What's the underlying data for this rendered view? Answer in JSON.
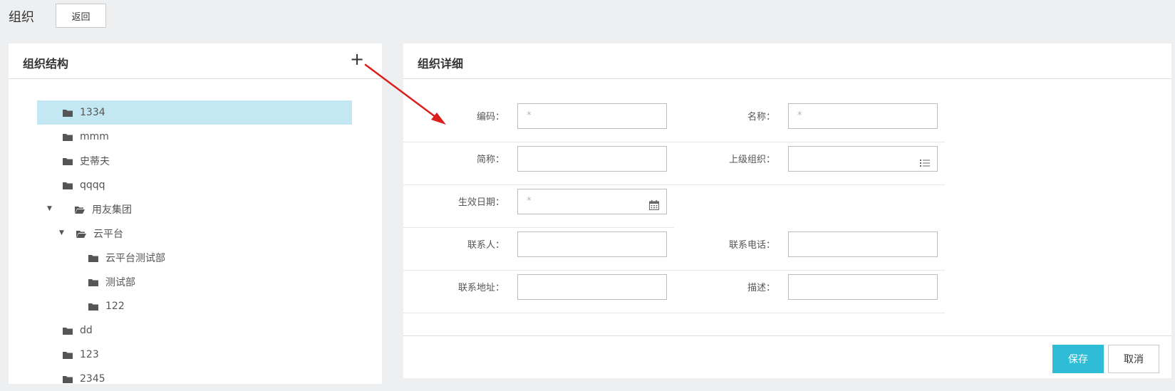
{
  "header": {
    "title": "组织",
    "back_label": "返回"
  },
  "org_tree": {
    "title": "组织结构",
    "add_icon": "plus-icon",
    "nodes": [
      {
        "label": "1334",
        "selected": true,
        "depth": 0,
        "expandable": false
      },
      {
        "label": "mmm",
        "depth": 0,
        "expandable": false
      },
      {
        "label": "史蒂夫",
        "depth": 0,
        "expandable": false
      },
      {
        "label": "qqqq",
        "depth": 0,
        "expandable": false
      },
      {
        "label": "用友集团",
        "depth": 0,
        "expandable": true,
        "expanded": true
      },
      {
        "label": "云平台",
        "depth": 1,
        "expandable": true,
        "expanded": true
      },
      {
        "label": "云平台测试部",
        "depth": 2,
        "expandable": false
      },
      {
        "label": "测试部",
        "depth": 2,
        "expandable": false
      },
      {
        "label": "122",
        "depth": 2,
        "expandable": false
      },
      {
        "label": "dd",
        "depth": 0,
        "expandable": false
      },
      {
        "label": "123",
        "depth": 0,
        "expandable": false
      },
      {
        "label": "2345",
        "depth": 0,
        "expandable": false
      }
    ]
  },
  "detail": {
    "title": "组织详细",
    "fields": {
      "code": {
        "label": "编码：",
        "value": "",
        "placeholder": "*"
      },
      "name": {
        "label": "名称：",
        "value": "",
        "placeholder": "*"
      },
      "short_name": {
        "label": "简称：",
        "value": ""
      },
      "parent_org": {
        "label": "上级组织：",
        "value": "",
        "icon": "list-icon"
      },
      "effective_date": {
        "label": "生效日期：",
        "value": "",
        "placeholder": "*",
        "icon": "calendar-icon"
      },
      "contact": {
        "label": "联系人：",
        "value": ""
      },
      "phone": {
        "label": "联系电话：",
        "value": ""
      },
      "address": {
        "label": "联系地址：",
        "value": ""
      },
      "description": {
        "label": "描述：",
        "value": ""
      }
    },
    "save_label": "保存",
    "cancel_label": "取消"
  },
  "colors": {
    "accent": "#2ebcd7",
    "selected_row": "#c3e8f4",
    "annotation_arrow": "#d9201f"
  }
}
